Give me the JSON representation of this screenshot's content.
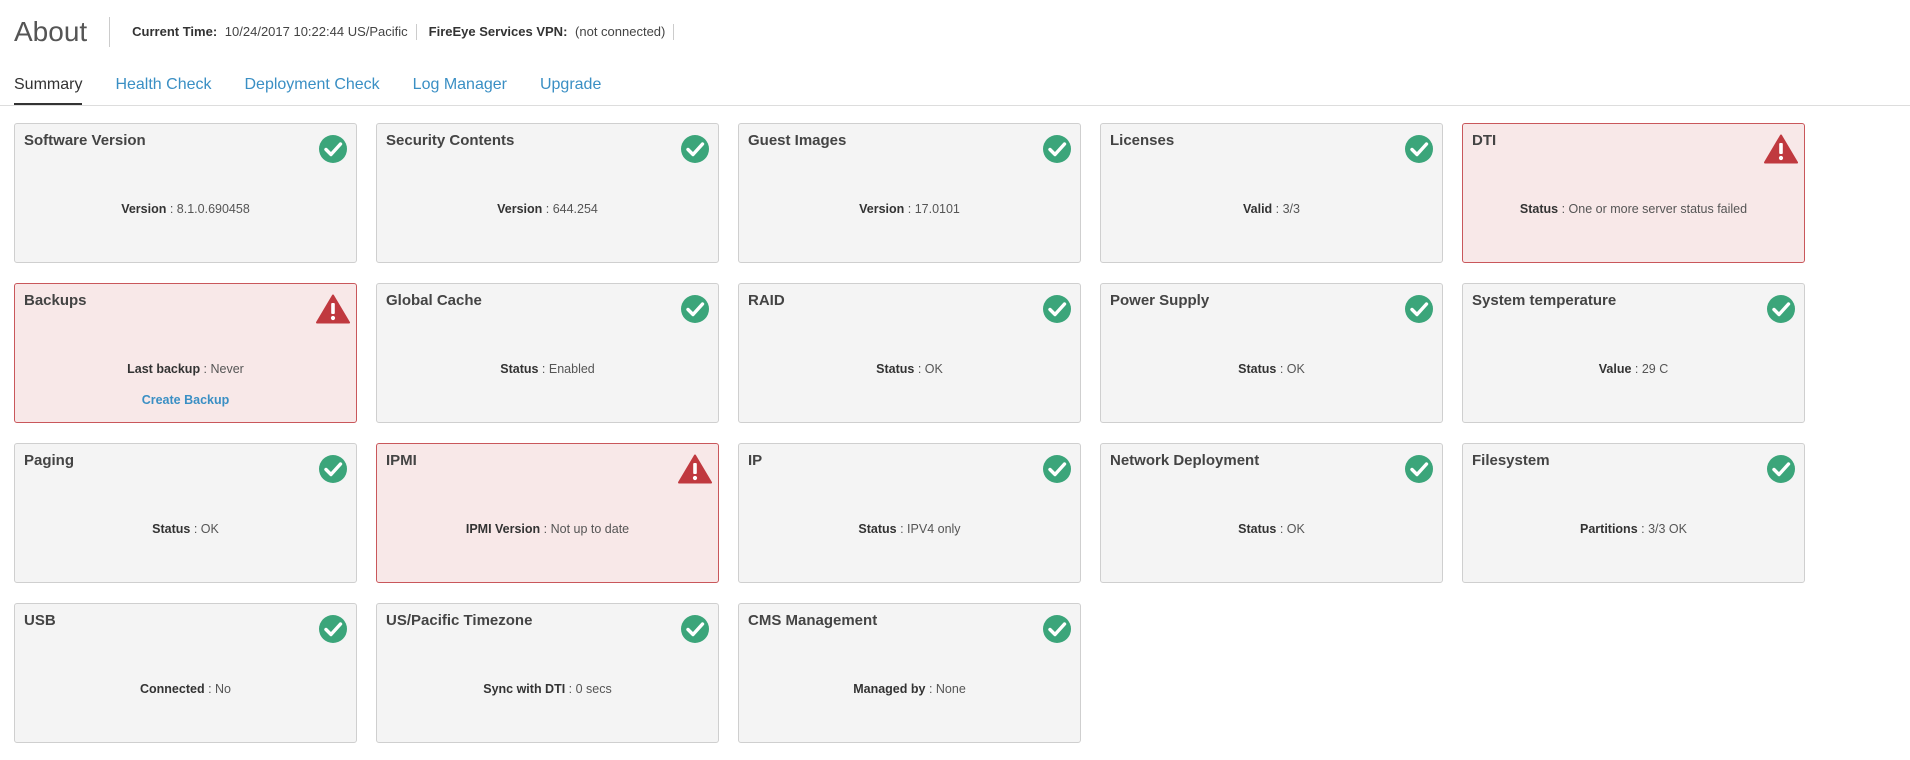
{
  "header": {
    "title": "About",
    "current_time_label": "Current Time:",
    "current_time_value": "10/24/2017 10:22:44 US/Pacific",
    "vpn_label": "FireEye Services VPN:",
    "vpn_value": "(not connected)"
  },
  "tabs": [
    {
      "label": "Summary",
      "active": true
    },
    {
      "label": "Health Check",
      "active": false
    },
    {
      "label": "Deployment Check",
      "active": false
    },
    {
      "label": "Log Manager",
      "active": false
    },
    {
      "label": "Upgrade",
      "active": false
    }
  ],
  "colors": {
    "ok": "#3ba57a",
    "warn": "#c0393f",
    "link": "#3a8fc4"
  },
  "cards": [
    {
      "title": "Software Version",
      "label": "Version",
      "value": "8.1.0.690458",
      "status": "ok"
    },
    {
      "title": "Security Contents",
      "label": "Version",
      "value": "644.254",
      "status": "ok"
    },
    {
      "title": "Guest Images",
      "label": "Version",
      "value": "17.0101",
      "status": "ok"
    },
    {
      "title": "Licenses",
      "label": "Valid",
      "value": "3/3",
      "status": "ok"
    },
    {
      "title": "DTI",
      "label": "Status",
      "value": "One or more server status failed",
      "status": "warn"
    },
    {
      "title": "Backups",
      "label": "Last backup",
      "value": "Never",
      "status": "warn",
      "link": "Create Backup"
    },
    {
      "title": "Global Cache",
      "label": "Status",
      "value": "Enabled",
      "status": "ok"
    },
    {
      "title": "RAID",
      "label": "Status",
      "value": "OK",
      "status": "ok"
    },
    {
      "title": "Power Supply",
      "label": "Status",
      "value": "OK",
      "status": "ok"
    },
    {
      "title": "System temperature",
      "label": "Value",
      "value": "29 C",
      "status": "ok"
    },
    {
      "title": "Paging",
      "label": "Status",
      "value": "OK",
      "status": "ok"
    },
    {
      "title": "IPMI",
      "label": "IPMI Version",
      "value": "Not up to date",
      "status": "warn"
    },
    {
      "title": "IP",
      "label": "Status",
      "value": "IPV4 only",
      "status": "ok"
    },
    {
      "title": "Network Deployment",
      "label": "Status",
      "value": "OK",
      "status": "ok"
    },
    {
      "title": "Filesystem",
      "label": "Partitions",
      "value": "3/3 OK",
      "status": "ok"
    },
    {
      "title": "USB",
      "label": "Connected",
      "value": "No",
      "status": "ok"
    },
    {
      "title": "US/Pacific Timezone",
      "label": "Sync with DTI",
      "value": "0 secs",
      "status": "ok"
    },
    {
      "title": "CMS Management",
      "label": "Managed by",
      "value": "None",
      "status": "ok"
    }
  ]
}
